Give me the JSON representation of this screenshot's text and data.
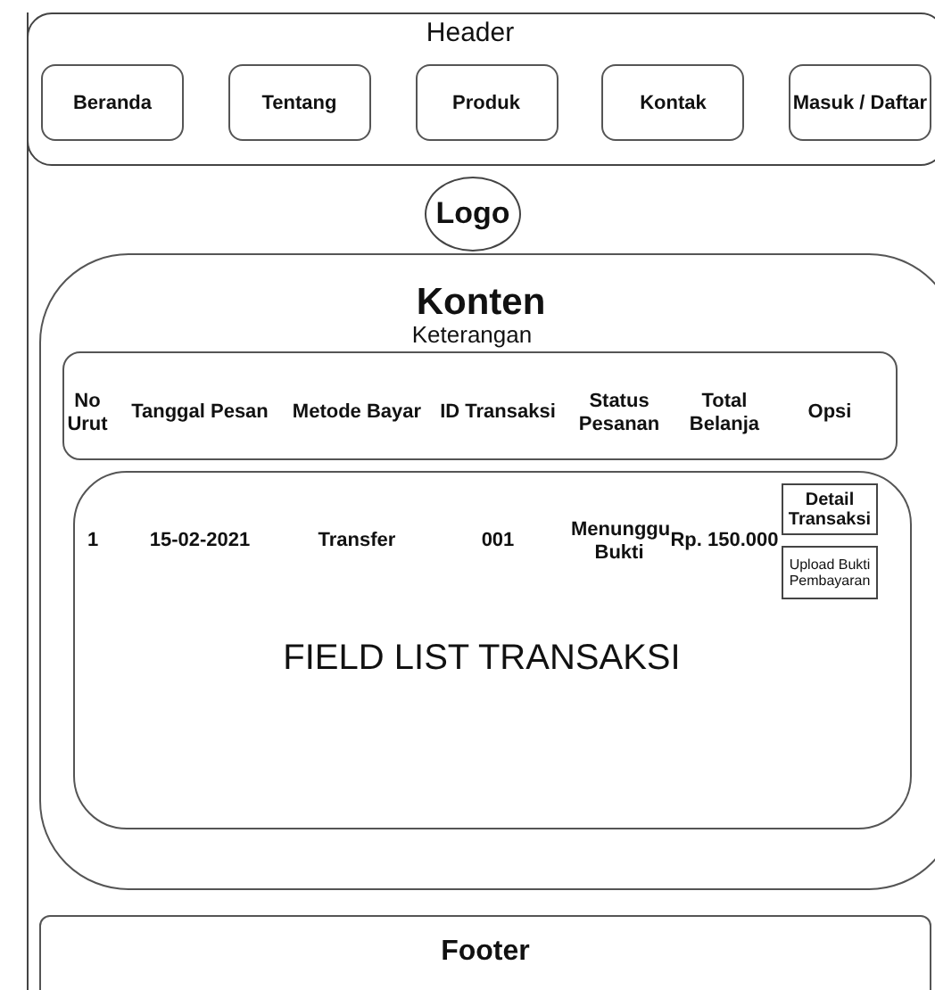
{
  "header": {
    "title": "Header",
    "nav": [
      "Beranda",
      "Tentang",
      "Produk",
      "Kontak",
      "Masuk / Daftar"
    ]
  },
  "logo": "Logo",
  "content": {
    "title": "Konten",
    "subtitle": "Keterangan",
    "table": {
      "columns": [
        "No Urut",
        "Tanggal Pesan",
        "Metode Bayar",
        "ID Transaksi",
        "Status Pesanan",
        "Total Belanja",
        "Opsi"
      ],
      "rows": [
        {
          "cells": [
            "1",
            "15-02-2021",
            "Transfer",
            "001",
            "Menunggu Bukti",
            "Rp. 150.000"
          ],
          "actions": [
            "Detail Transaksi",
            "Upload Bukti Pembayaran"
          ]
        }
      ]
    },
    "list_label": "FIELD LIST TRANSAKSI"
  },
  "footer": "Footer"
}
